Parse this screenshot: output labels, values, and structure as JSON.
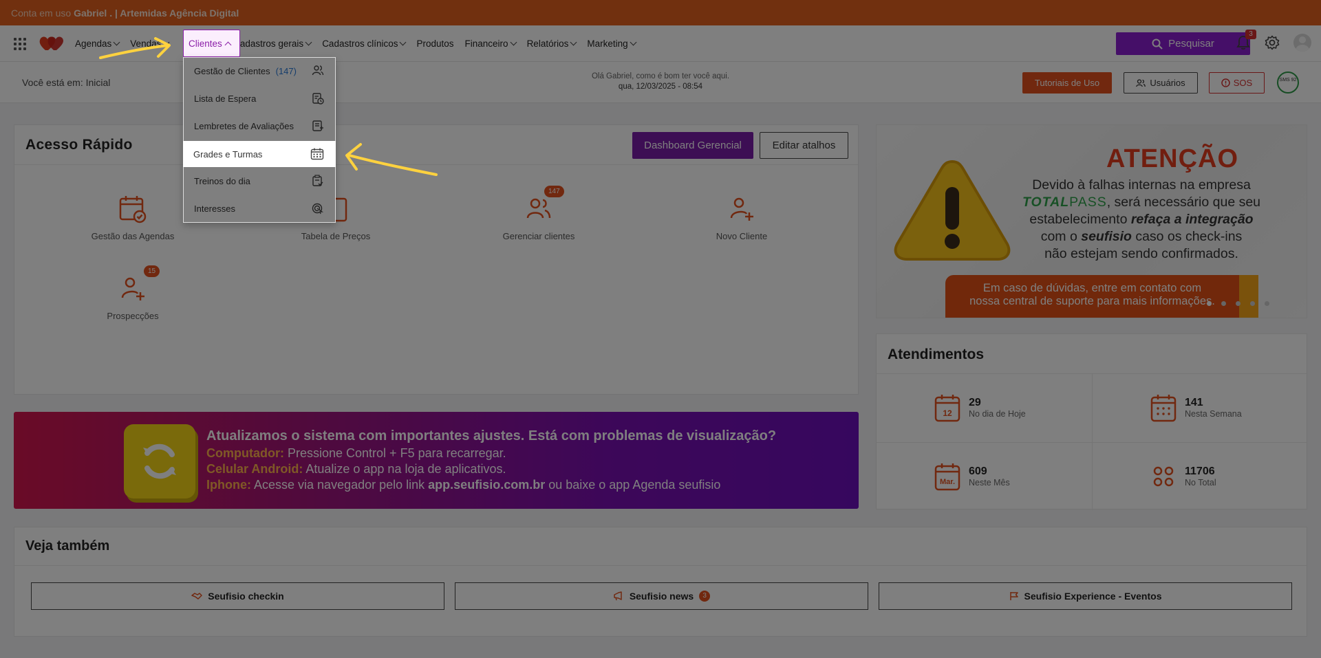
{
  "account_bar": {
    "prefix": "Conta em uso",
    "account": "Gabriel . | Artemidas Agência Digital"
  },
  "nav": {
    "items": [
      {
        "label": "Agendas",
        "chev": true
      },
      {
        "label": "Vendas",
        "chev": true
      },
      {
        "label": "Clientes",
        "chev": true,
        "active": true
      },
      {
        "label": "Cadastros gerais",
        "chev": true
      },
      {
        "label": "Cadastros clínicos",
        "chev": true
      },
      {
        "label": "Produtos",
        "chev": false
      },
      {
        "label": "Financeiro",
        "chev": true
      },
      {
        "label": "Relatórios",
        "chev": true
      },
      {
        "label": "Marketing",
        "chev": true
      }
    ],
    "search_label": "Pesquisar",
    "notif_count": "3"
  },
  "subheader": {
    "breadcrumb": "Você está em: Inicial",
    "greeting": "Olá Gabriel, como é bom ter você aqui.",
    "datetime": "qua, 12/03/2025 - 08:54",
    "tutorials_label": "Tutoriais de Uso",
    "users_label": "Usuários",
    "sos_label": "SOS",
    "seal_text": "SMS 92"
  },
  "dropdown": {
    "items": [
      {
        "label": "Gestão de Clientes",
        "count": "(147)",
        "icon": "users-icon"
      },
      {
        "label": "Lista de Espera",
        "icon": "clipboard-clock-icon"
      },
      {
        "label": "Lembretes de Avaliações",
        "icon": "clipboard-list-icon"
      },
      {
        "label": "Grades e Turmas",
        "icon": "calendar-grid-icon",
        "selected": true
      },
      {
        "label": "Treinos do dia",
        "icon": "clipboard-check-icon"
      },
      {
        "label": "Interesses",
        "icon": "target-icon"
      }
    ]
  },
  "quick_access": {
    "title": "Acesso Rápido",
    "dashboard_label": "Dashboard Gerencial",
    "edit_label": "Editar atalhos",
    "items": [
      {
        "label": "Gestão das Agendas",
        "icon": "calendar-check-icon"
      },
      {
        "label": "Tabela de Preços",
        "icon": "price-table-icon"
      },
      {
        "label": "Gerenciar clientes",
        "icon": "users-icon",
        "badge": "147"
      },
      {
        "label": "Novo Cliente",
        "icon": "user-plus-icon"
      },
      {
        "label": "Prospecções",
        "icon": "user-plus-icon",
        "badge": "15"
      }
    ]
  },
  "attention_banner": {
    "title": "ATENÇÃO",
    "line1": "Devido à falhas internas na empresa",
    "brand_a": "TOTAL",
    "brand_b": "PASS",
    "line2": ", será necessário que seu",
    "line3a": "estabelecimento ",
    "line3b": "refaça a integração",
    "line4a": "com o ",
    "line4b": "seufisio",
    "line4c": " caso os check-ins",
    "line5": "não estejam sendo confirmados.",
    "foot1": "Em caso de dúvidas, entre em contato com",
    "foot2": "nossa central de suporte para mais informações."
  },
  "atendimentos": {
    "title": "Atendimentos",
    "stats": [
      {
        "num": "29",
        "label": "No dia de Hoje",
        "icon_text": "12"
      },
      {
        "num": "141",
        "label": "Nesta Semana",
        "icon_text": ""
      },
      {
        "num": "609",
        "label": "Neste Mês",
        "icon_text": "Mar."
      },
      {
        "num": "11706",
        "label": "No Total",
        "icon_text": ""
      }
    ]
  },
  "update_banner": {
    "title": "Atualizamos o sistema com importantes ajustes. Está com problemas de visualização?",
    "l1k": "Computador:",
    "l1": " Pressione Control + F5 para recarregar.",
    "l2k": "Celular Android:",
    "l2": " Atualize o app na loja de aplicativos.",
    "l3k": "Iphone:",
    "l3a": " Acesse via navegador pelo link ",
    "l3b": "app.seufisio.com.br",
    "l3c": " ou baixe o app Agenda seufisio"
  },
  "see_also": {
    "title": "Veja também",
    "buttons": [
      {
        "label": "Seufisio checkin",
        "icon": "handshake-icon"
      },
      {
        "label": "Seufisio news",
        "icon": "megaphone-icon",
        "badge": "3"
      },
      {
        "label": "Seufisio Experience - Eventos",
        "icon": "flag-icon"
      }
    ]
  },
  "colors": {
    "accent_orange": "#e2511e",
    "accent_purple": "#8b1fd1",
    "highlight_arrow": "#ffd23f"
  }
}
